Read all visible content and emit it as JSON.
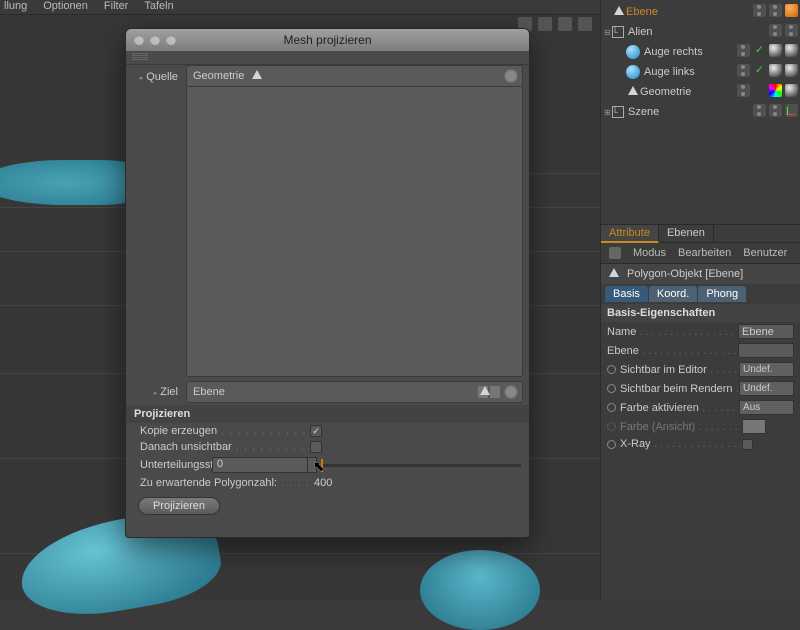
{
  "menubar": {
    "items": [
      "llung",
      "Optionen",
      "Filter",
      "Tafeln"
    ]
  },
  "dialog": {
    "title": "Mesh projizieren",
    "quelle_label": "Quelle",
    "quelle_value": "Geometrie",
    "ziel_label": "Ziel",
    "ziel_value": "Ebene",
    "section": "Projizieren",
    "kopie_label": "Kopie erzeugen",
    "kopie_checked": true,
    "danach_label": "Danach unsichtbar",
    "danach_checked": false,
    "unterteil_label": "Unterteilungsstufe",
    "unterteil_value": "0",
    "polyzahl_label": "Zu erwartende Polygonzahl:",
    "polyzahl_value": "400",
    "button": "Projizieren"
  },
  "objects": {
    "tree": [
      {
        "name": "Ebene",
        "type": "plane",
        "level": 0,
        "sel": true,
        "tags": [
          "vis",
          "vis",
          "tagorange"
        ]
      },
      {
        "name": "Alien",
        "type": "null",
        "level": 0,
        "exp": "⊟",
        "tags": [
          "vis",
          "vis"
        ]
      },
      {
        "name": "Auge rechts",
        "type": "sphere",
        "level": 1,
        "tags": [
          "vis",
          "chk",
          "tagball",
          "tagball"
        ]
      },
      {
        "name": "Auge links",
        "type": "sphere",
        "level": 1,
        "tags": [
          "vis",
          "chk",
          "tagball",
          "tagball"
        ]
      },
      {
        "name": "Geometrie",
        "type": "plane",
        "level": 1,
        "tags": [
          "vis",
          "",
          "tagcolor",
          "tagball"
        ]
      },
      {
        "name": "Szene",
        "type": "null",
        "level": 0,
        "exp": "⊞",
        "tags": [
          "vis",
          "vis",
          "axis"
        ]
      }
    ]
  },
  "attributes": {
    "tabs": [
      "Attribute",
      "Ebenen"
    ],
    "menu": [
      "Modus",
      "Bearbeiten",
      "Benutzer"
    ],
    "obj_header": "Polygon-Objekt [Ebene]",
    "subtabs": [
      "Basis",
      "Koord.",
      "Phong"
    ],
    "group": "Basis-Eigenschaften",
    "props": {
      "name_label": "Name",
      "name_value": "Ebene",
      "ebene_label": "Ebene",
      "ebene_value": "",
      "sicht_editor_label": "Sichtbar im Editor",
      "sicht_editor_value": "Undef.",
      "sicht_render_label": "Sichtbar beim Rendern",
      "sicht_render_value": "Undef.",
      "farbe_akt_label": "Farbe aktivieren",
      "farbe_akt_value": "Aus",
      "farbe_ansicht_label": "Farbe (Ansicht)",
      "xray_label": "X-Ray"
    }
  }
}
